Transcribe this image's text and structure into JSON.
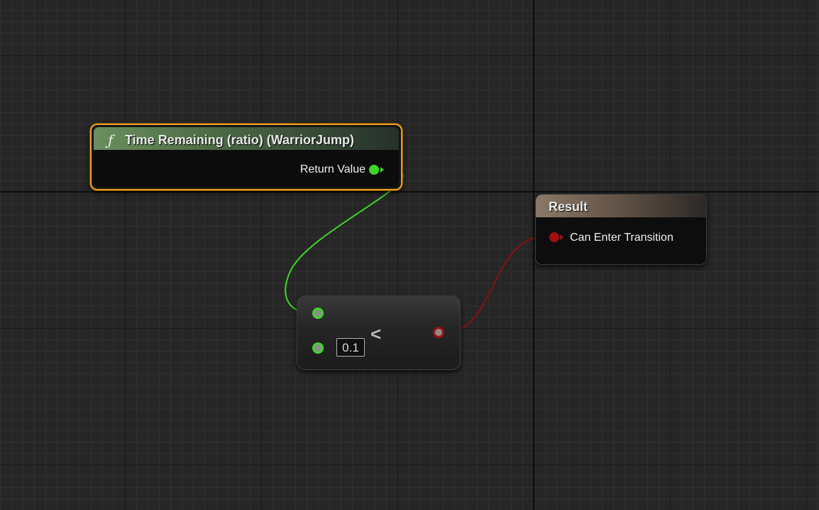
{
  "graph": {
    "colors": {
      "background": "#262626",
      "float_pin": "#3ed62a",
      "bool_pin": "#a01010",
      "selected_outline": "#f0a020"
    }
  },
  "function_node": {
    "icon": "function-icon",
    "icon_glyph": "ƒ",
    "title": "Time Remaining (ratio) (WarriorJump)",
    "output_label": "Return Value",
    "selected": true
  },
  "result_node": {
    "title": "Result",
    "input_label": "Can Enter Transition"
  },
  "compare_node": {
    "operator": "<",
    "input_b_value": "0.1"
  }
}
